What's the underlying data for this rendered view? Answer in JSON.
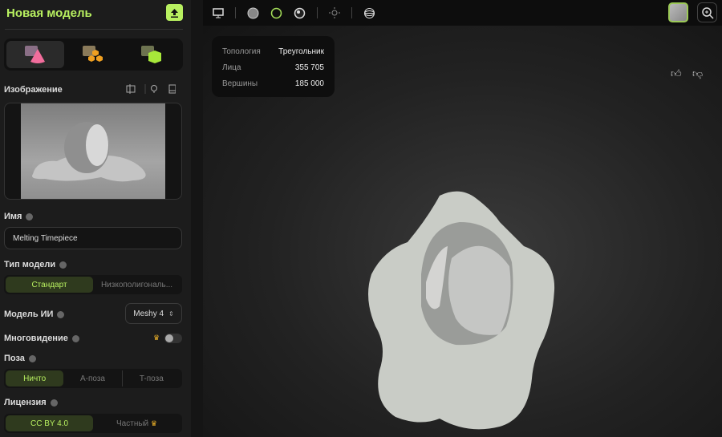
{
  "sidebar": {
    "title": "Новая модель",
    "image_label": "Изображение",
    "name_label": "Имя",
    "name_value": "Melting Timepiece",
    "model_type_label": "Тип модели",
    "model_types": [
      "Стандарт",
      "Низкополигональ..."
    ],
    "ai_model_label": "Модель ИИ",
    "ai_model_value": "Meshy 4",
    "multiview_label": "Многовидение",
    "multiview_on": false,
    "pose_label": "Поза",
    "poses": [
      "Ничто",
      "A-поза",
      "T-поза"
    ],
    "license_label": "Лицензия",
    "licenses": [
      "CC BY 4.0",
      "Частный"
    ]
  },
  "stats": {
    "topology_label": "Топология",
    "topology_value": "Треугольник",
    "faces_label": "Лица",
    "faces_value": "355 705",
    "vertices_label": "Вершины",
    "vertices_value": "185 000"
  },
  "colors": {
    "accent": "#b8f060"
  }
}
